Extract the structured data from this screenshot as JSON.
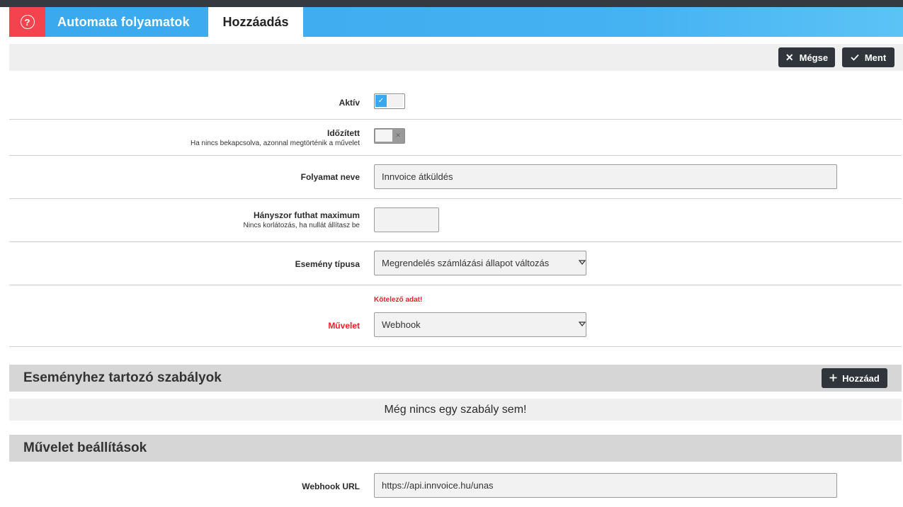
{
  "header": {
    "help_glyph": "?",
    "app_title": "Automata folyamatok",
    "active_tab": "Hozzáadás"
  },
  "toolbar": {
    "cancel_label": "Mégse",
    "save_label": "Ment"
  },
  "form": {
    "active": {
      "label": "Aktív",
      "value": true
    },
    "scheduled": {
      "label": "Időzített",
      "hint": "Ha nincs bekapcsolva, azonnal megtörténik a művelet",
      "value": false
    },
    "process_name": {
      "label": "Folyamat neve",
      "value": "Innvoice átküldés"
    },
    "max_runs": {
      "label": "Hányszor futhat maximum",
      "hint": "Nincs korlátozás, ha nullát állítasz be",
      "value": ""
    },
    "event_type": {
      "label": "Esemény típusa",
      "value": "Megrendelés számlázási állapot változás"
    },
    "action": {
      "label": "Művelet",
      "error": "Kötelező adat!",
      "value": "Webhook"
    }
  },
  "rules_section": {
    "title": "Eseményhez tartozó szabályok",
    "add_label": "Hozzáad",
    "empty_text": "Még nincs egy szabály sem!"
  },
  "action_settings": {
    "title": "Művelet beállítások",
    "webhook_url": {
      "label": "Webhook URL",
      "value": "https://api.innvoice.hu/unas"
    }
  },
  "colors": {
    "header_blue": "#3aa8ee",
    "help_red": "#f2434f",
    "dark_button": "#2f353b",
    "error_red": "#e8202a"
  }
}
